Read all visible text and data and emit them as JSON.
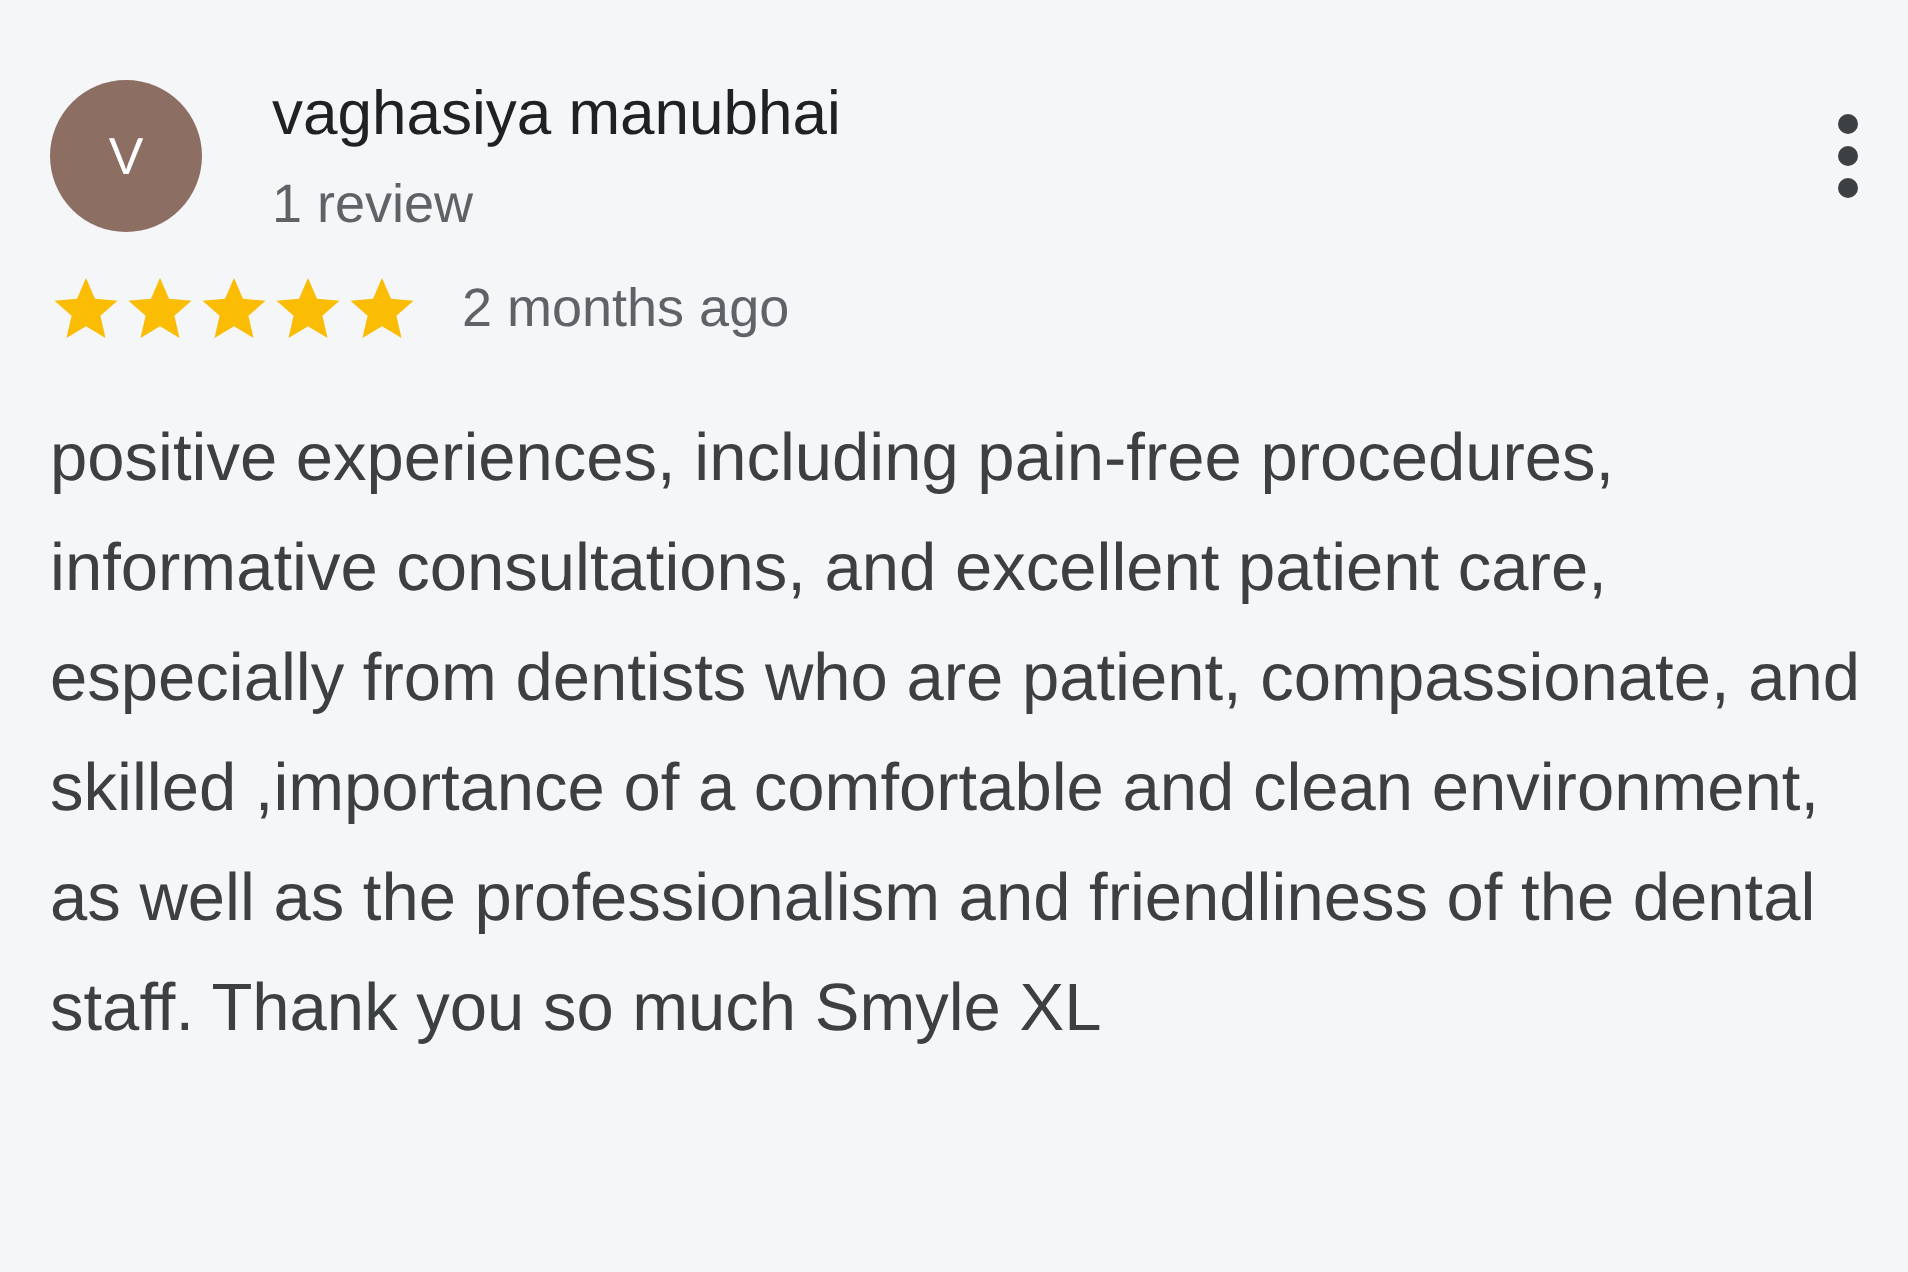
{
  "review": {
    "avatar_letter": "V",
    "author": "vaghasiya manubhai",
    "author_reviews": "1 review",
    "stars": 5,
    "time": "2 months ago",
    "text": "positive experiences, including pain-free procedures, informative consultations, and excellent patient care, especially from dentists who are patient, compassionate, and skilled ,importance of a comfortable and clean environment, as well as the professionalism and friendliness of the dental staff. Thank you so much Smyle XL"
  }
}
